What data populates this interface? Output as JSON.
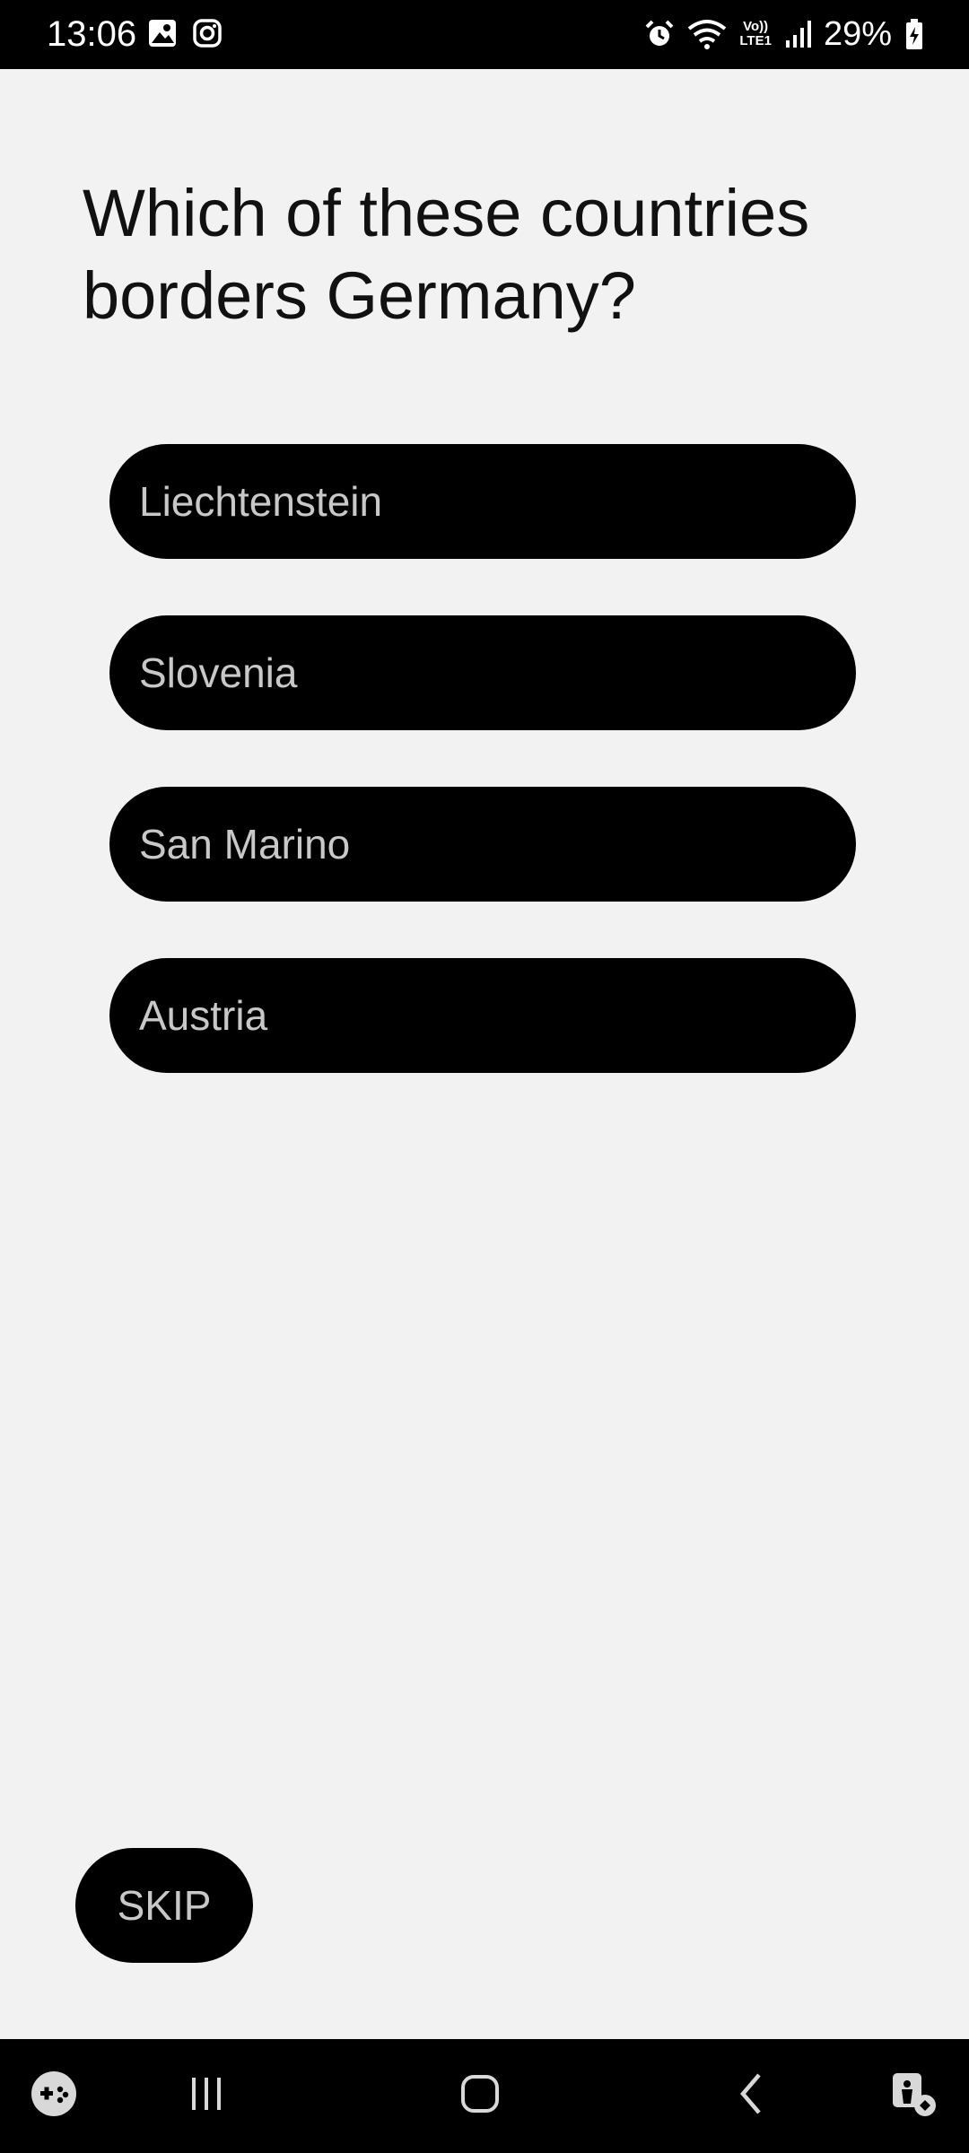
{
  "status_bar": {
    "time": "13:06",
    "battery": "29%",
    "network": "LTE1",
    "icons": [
      "gallery-icon",
      "instagram-icon",
      "alarm-icon",
      "wifi-icon",
      "volte-icon",
      "signal-icon",
      "battery-charging-icon"
    ]
  },
  "quiz": {
    "question": "Which of these countries borders Germany?",
    "answers": [
      {
        "label": "Liechtenstein"
      },
      {
        "label": "Slovenia"
      },
      {
        "label": "San Marino"
      },
      {
        "label": "Austria"
      }
    ],
    "skip_label": "SKIP"
  },
  "nav_bar": {
    "icons": [
      "game-launcher-icon",
      "recent-apps-icon",
      "home-icon",
      "back-icon",
      "accessibility-icon"
    ]
  }
}
